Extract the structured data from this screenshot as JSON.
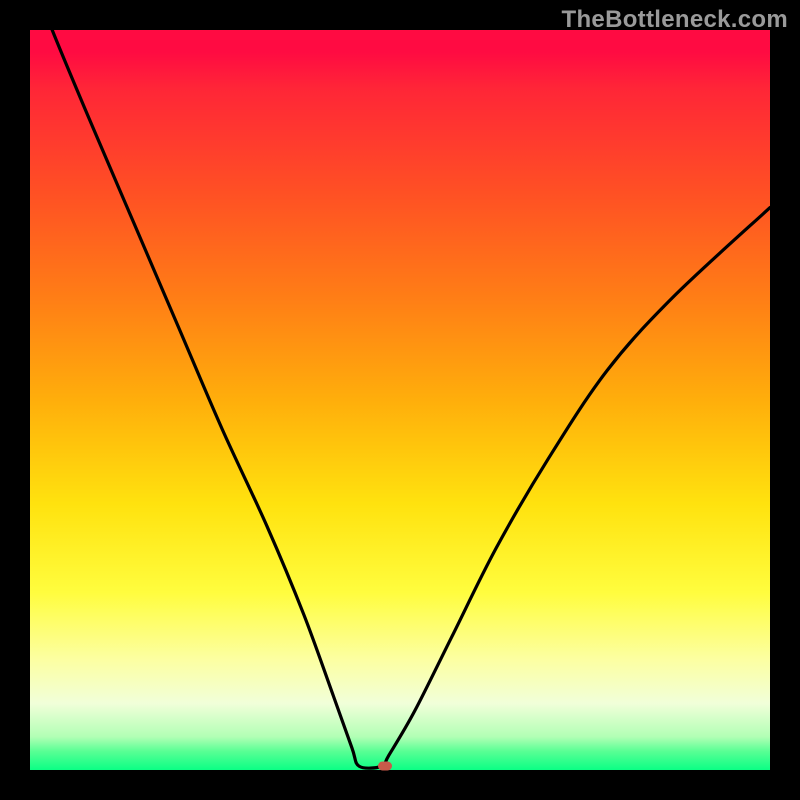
{
  "watermark": "TheBottleneck.com",
  "colors": {
    "frame_bg": "#000000",
    "gradient_top": "#ff0b42",
    "gradient_bottom": "#0bff85",
    "curve_stroke": "#000000",
    "marker_fill": "#c85a4a",
    "watermark_text": "#9a9a9a"
  },
  "chart_data": {
    "type": "line",
    "title": "",
    "xlabel": "",
    "ylabel": "",
    "xlim": [
      0,
      100
    ],
    "ylim": [
      0,
      100
    ],
    "note": "Curve drops steeply from upper-left, reaches zero around x≈44-48, then rises toward upper-right. Background gradient encodes value: red high, green low.",
    "series": [
      {
        "name": "bottleneck-curve",
        "x": [
          0,
          3,
          8,
          14,
          20,
          26,
          32,
          37,
          41,
          43.5,
          44.5,
          47.5,
          48.5,
          52,
          57,
          63,
          70,
          78,
          87,
          100
        ],
        "values": [
          108,
          100,
          88,
          74,
          60,
          46,
          33,
          21,
          10,
          3,
          0.5,
          0.5,
          2,
          8,
          18,
          30,
          42,
          54,
          64,
          76
        ]
      }
    ],
    "marker": {
      "x": 48,
      "y": 0.5
    }
  }
}
